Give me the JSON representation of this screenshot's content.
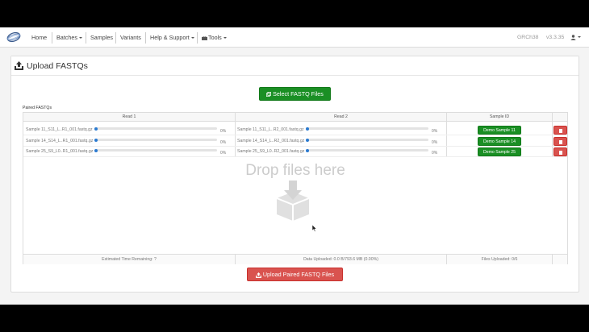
{
  "navbar": {
    "items": [
      {
        "label": "Home"
      },
      {
        "label": "Batches"
      },
      {
        "label": "Samples"
      },
      {
        "label": "Variants"
      },
      {
        "label": "Help & Support"
      },
      {
        "label": "Tools"
      }
    ],
    "genome": "GRCh38",
    "version": "v3.3.35"
  },
  "panel": {
    "title": "Upload FASTQs",
    "select_button": "Select FASTQ Files",
    "paired_label": "Paired FASTQs",
    "upload_button": "Upload Paired FASTQ Files"
  },
  "table": {
    "headers": [
      "Read 1",
      "Read 2",
      "Sample ID"
    ],
    "rows": [
      {
        "read1": "Sample 11_S11_L..R1_001.fastq.gz",
        "read1_pct": "0%",
        "read2": "Sample 11_S11_L..R2_001.fastq.gz",
        "read2_pct": "0%",
        "sample_id": "Demo Sample 11"
      },
      {
        "read1": "Sample 14_S14_L..R1_001.fastq.gz",
        "read1_pct": "0%",
        "read2": "Sample 14_S14_L..R2_001.fastq.gz",
        "read2_pct": "0%",
        "sample_id": "Demo Sample 14"
      },
      {
        "read1": "Sample 25_S9_L0..R1_001.fastq.gz",
        "read1_pct": "0%",
        "read2": "Sample 25_S9_L0..R2_001.fastq.gz",
        "read2_pct": "0%",
        "sample_id": "Demo Sample 25"
      }
    ],
    "drop_text": "Drop files here",
    "footer": {
      "time_remaining": "Estimated Time Remaining: ?",
      "data_uploaded": "Data Uploaded: 0.0 B/793.6 MB (0.00%)",
      "files_uploaded": "Files Uploaded: 0/6"
    }
  },
  "colors": {
    "green": "#1a8f24",
    "red": "#d9534f",
    "progress": "#2a7ad0"
  }
}
